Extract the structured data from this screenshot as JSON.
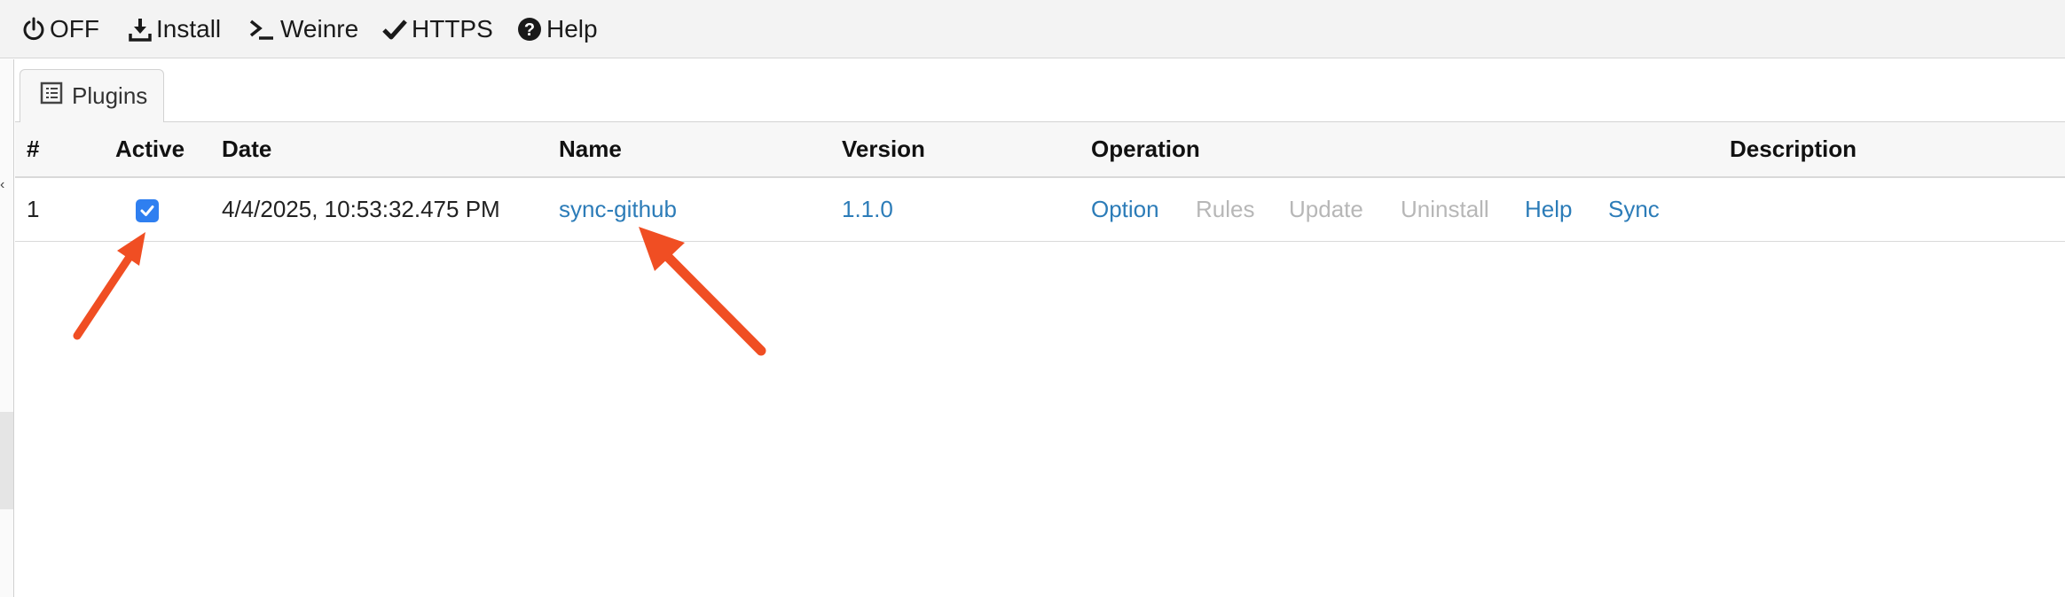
{
  "toolbar": {
    "off_label": "OFF",
    "install_label": "Install",
    "weinre_label": "Weinre",
    "https_label": "HTTPS",
    "help_label": "Help"
  },
  "tabs": [
    {
      "label": "Plugins"
    }
  ],
  "table": {
    "headers": {
      "num": "#",
      "active": "Active",
      "date": "Date",
      "name": "Name",
      "version": "Version",
      "operation": "Operation",
      "description": "Description"
    },
    "rows": [
      {
        "num": "1",
        "active": true,
        "date": "4/4/2025, 10:53:32.475 PM",
        "name": "sync-github",
        "version": "1.1.0",
        "operations": {
          "option": "Option",
          "rules": "Rules",
          "update": "Update",
          "uninstall": "Uninstall",
          "help": "Help",
          "sync": "Sync"
        },
        "description": ""
      }
    ]
  },
  "colors": {
    "link": "#2c7cb8",
    "disabled": "#b7b7b7",
    "checkbox": "#2f7ff0",
    "annotation_arrow": "#f04e23"
  }
}
